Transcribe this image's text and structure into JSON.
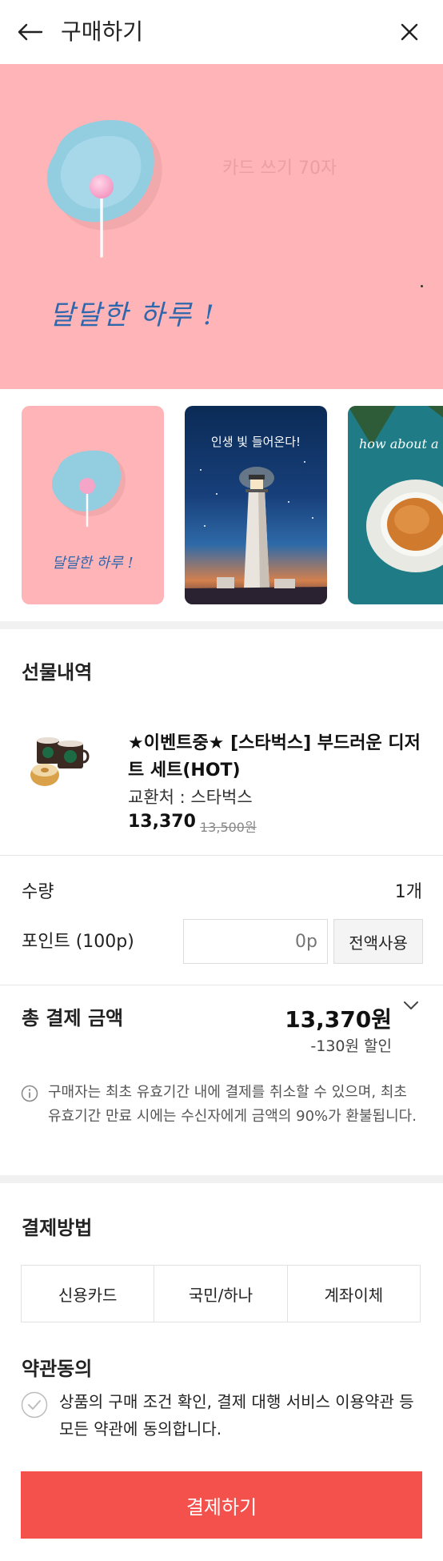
{
  "header": {
    "title": "구매하기"
  },
  "card": {
    "hint": "카드 쓰기 70자",
    "greeting": "달달한 하루 !"
  },
  "thumbnails": [
    {
      "caption": "달달한 하루 !"
    },
    {
      "caption": "인생 빛 들어온다!"
    },
    {
      "caption": "how about a cup of"
    }
  ],
  "gift": {
    "section_title": "선물내역",
    "product_name": "★이벤트중★ [스타벅스] 부드러운 디저트 세트(HOT)",
    "vendor": "교환처 : 스타벅스",
    "price": "13,370",
    "original_price": "13,500원"
  },
  "quantity": {
    "label": "수량",
    "value": "1개"
  },
  "points": {
    "label": "포인트 (100p)",
    "placeholder": "0p",
    "use_all_label": "전액사용"
  },
  "total": {
    "label": "총 결제 금액",
    "amount": "13,370원",
    "discount": "-130원 할인"
  },
  "notice": "구매자는 최초 유효기간 내에 결제를 취소할 수 있으며, 최초 유효기간 만료 시에는 수신자에게 금액의 90%가 환불됩니다.",
  "payment": {
    "section_title": "결제방법",
    "options": [
      "신용카드",
      "국민/하나",
      "계좌이체"
    ]
  },
  "terms": {
    "section_title": "약관동의",
    "text": "상품의 구매 조건 확인, 결제 대행 서비스 이용약관 등 모든 약관에 동의합니다."
  },
  "submit_label": "결제하기",
  "colors": {
    "card_background": "#ffb5b8",
    "accent": "#f4514c"
  }
}
